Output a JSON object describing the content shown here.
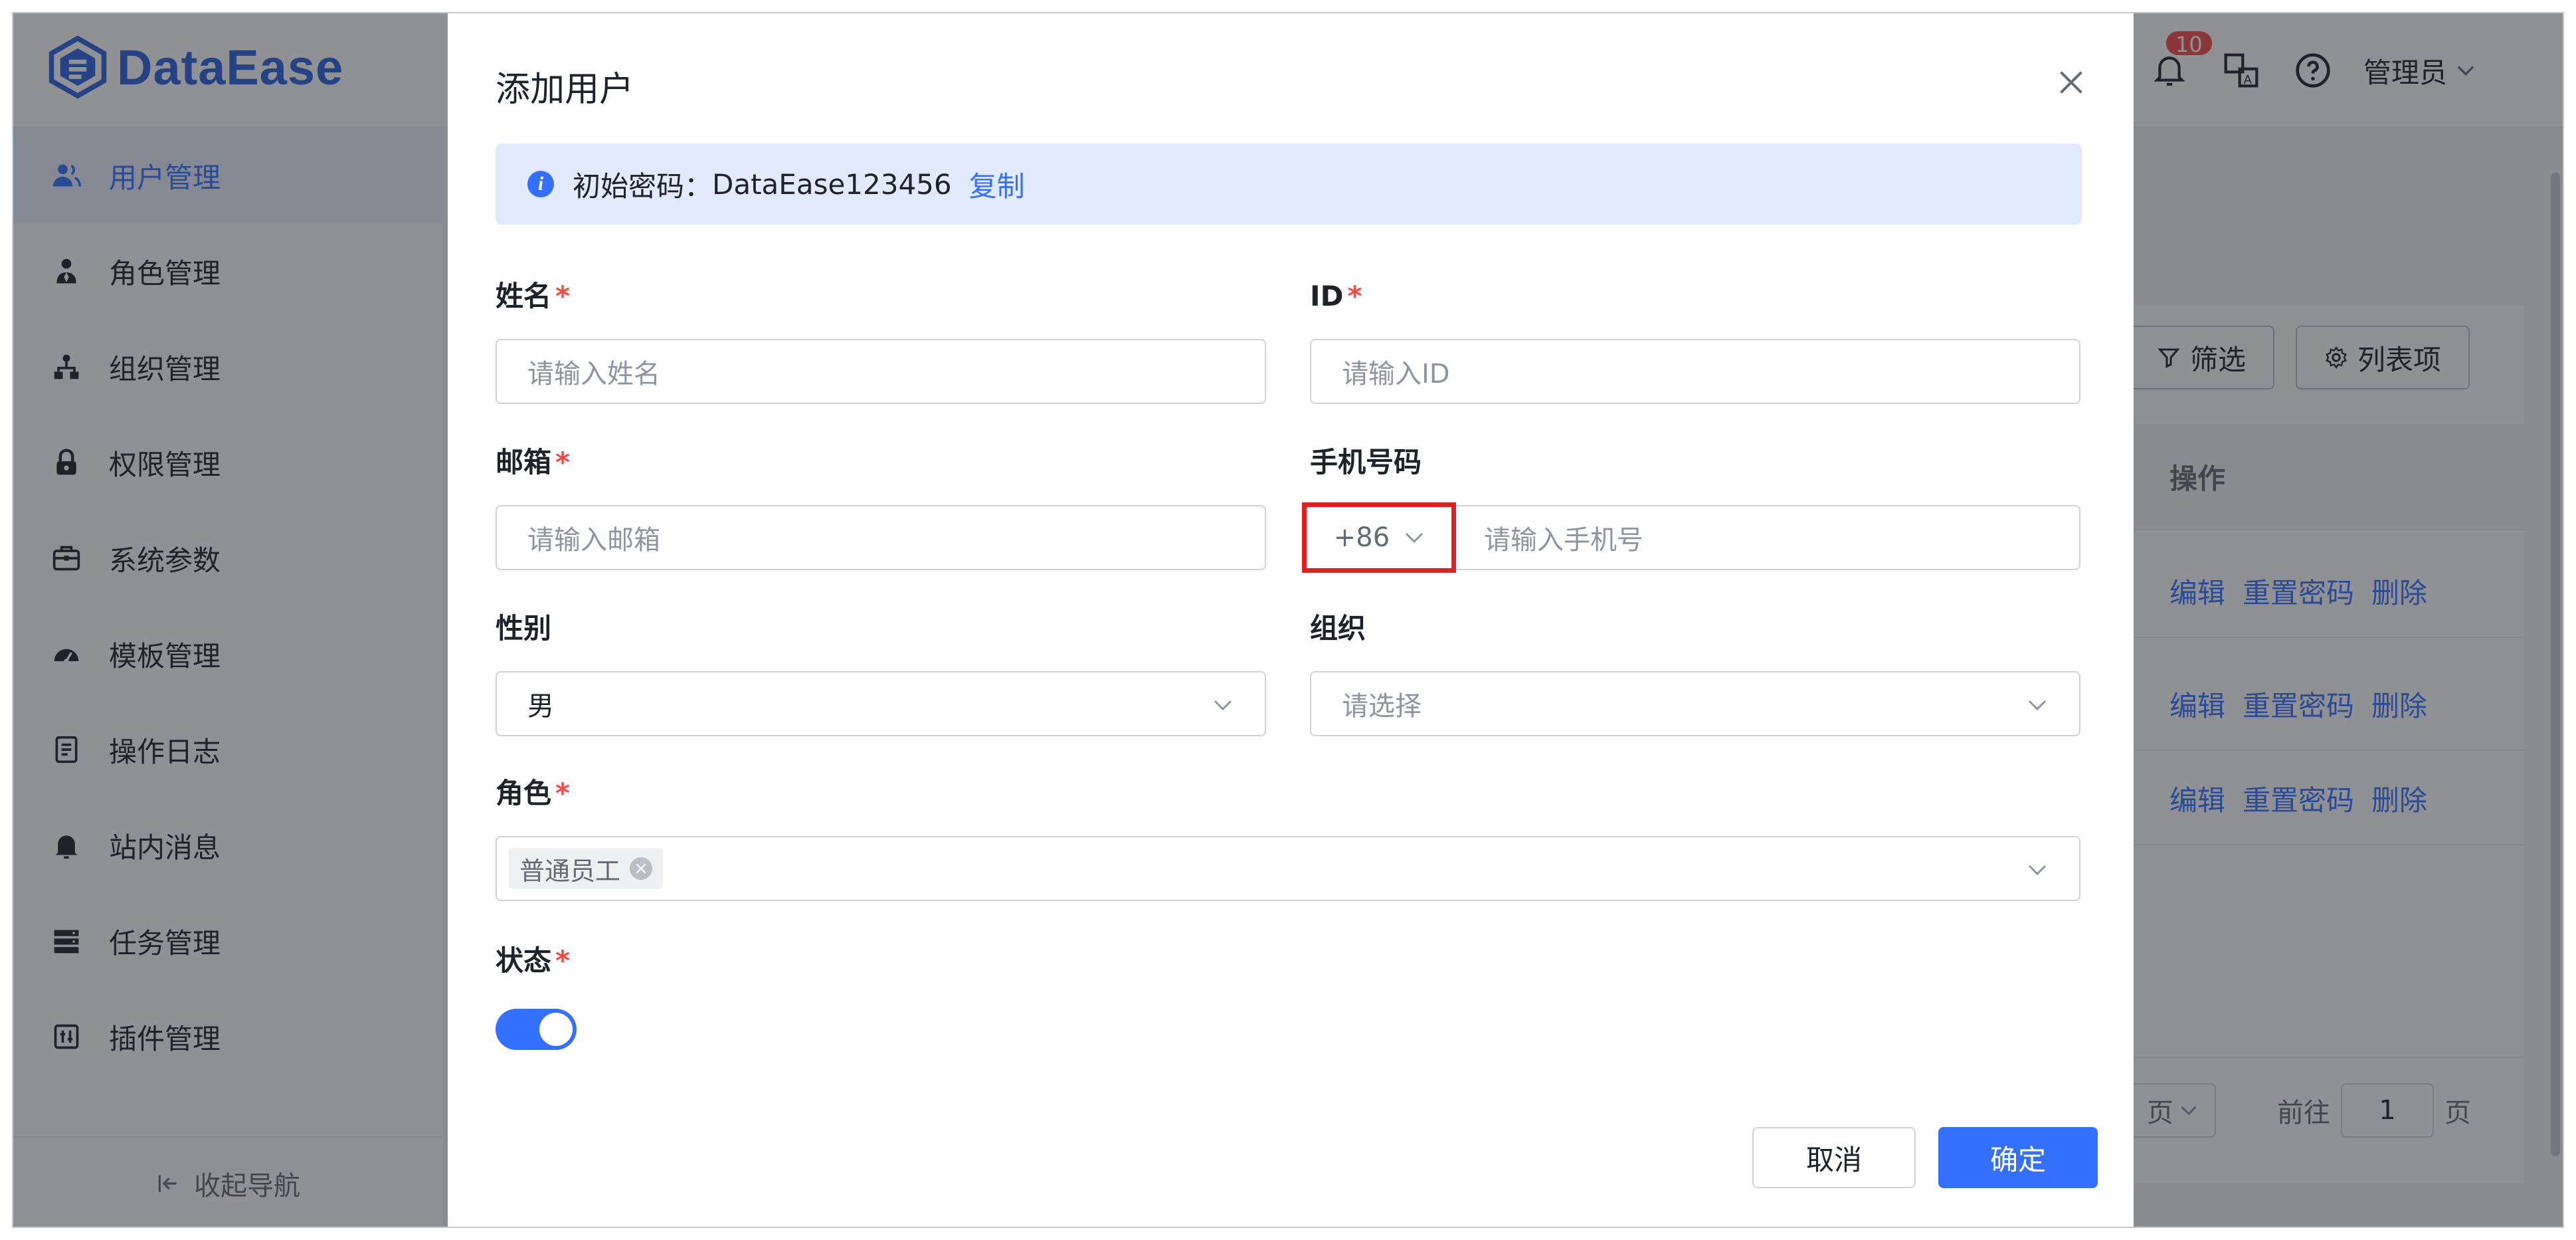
{
  "app": {
    "name": "DataEase",
    "brand_color": "#2b62df",
    "accent_color": "#3370ff"
  },
  "header": {
    "notification_count": "10",
    "user_name": "管理员"
  },
  "sidebar": {
    "items": [
      {
        "label": "用户管理",
        "icon": "user-icon",
        "active": true
      },
      {
        "label": "角色管理",
        "icon": "role-icon"
      },
      {
        "label": "组织管理",
        "icon": "org-icon"
      },
      {
        "label": "权限管理",
        "icon": "lock-icon"
      },
      {
        "label": "系统参数",
        "icon": "settings-box-icon"
      },
      {
        "label": "模板管理",
        "icon": "dashboard-icon"
      },
      {
        "label": "操作日志",
        "icon": "log-icon"
      },
      {
        "label": "站内消息",
        "icon": "bell-icon"
      },
      {
        "label": "任务管理",
        "icon": "task-icon"
      },
      {
        "label": "插件管理",
        "icon": "plugin-icon"
      }
    ],
    "collapse_label": "收起导航"
  },
  "content": {
    "filter_label": "筛选",
    "columns_label": "列表项",
    "table_header_action": "操作",
    "row_actions": {
      "edit": "编辑",
      "reset": "重置密码",
      "delete": "删除"
    },
    "pager": {
      "goto_label": "前往",
      "page": "1",
      "page_suffix": "页",
      "size_suffix": "页"
    }
  },
  "dialog": {
    "title": "添加用户",
    "alert": {
      "prefix": "初始密码：",
      "password": "DataEase123456",
      "copy": "复制"
    },
    "name": {
      "label": "姓名",
      "placeholder": "请输入姓名"
    },
    "id": {
      "label": "ID",
      "placeholder": "请输入ID"
    },
    "email": {
      "label": "邮箱",
      "placeholder": "请输入邮箱"
    },
    "phone": {
      "label": "手机号码",
      "country_code": "+86",
      "placeholder": "请输入手机号"
    },
    "gender": {
      "label": "性别",
      "value": "男"
    },
    "org": {
      "label": "组织",
      "placeholder": "请选择"
    },
    "role": {
      "label": "角色",
      "tag": "普通员工"
    },
    "status": {
      "label": "状态",
      "enabled": true
    },
    "cancel": "取消",
    "confirm": "确定"
  }
}
